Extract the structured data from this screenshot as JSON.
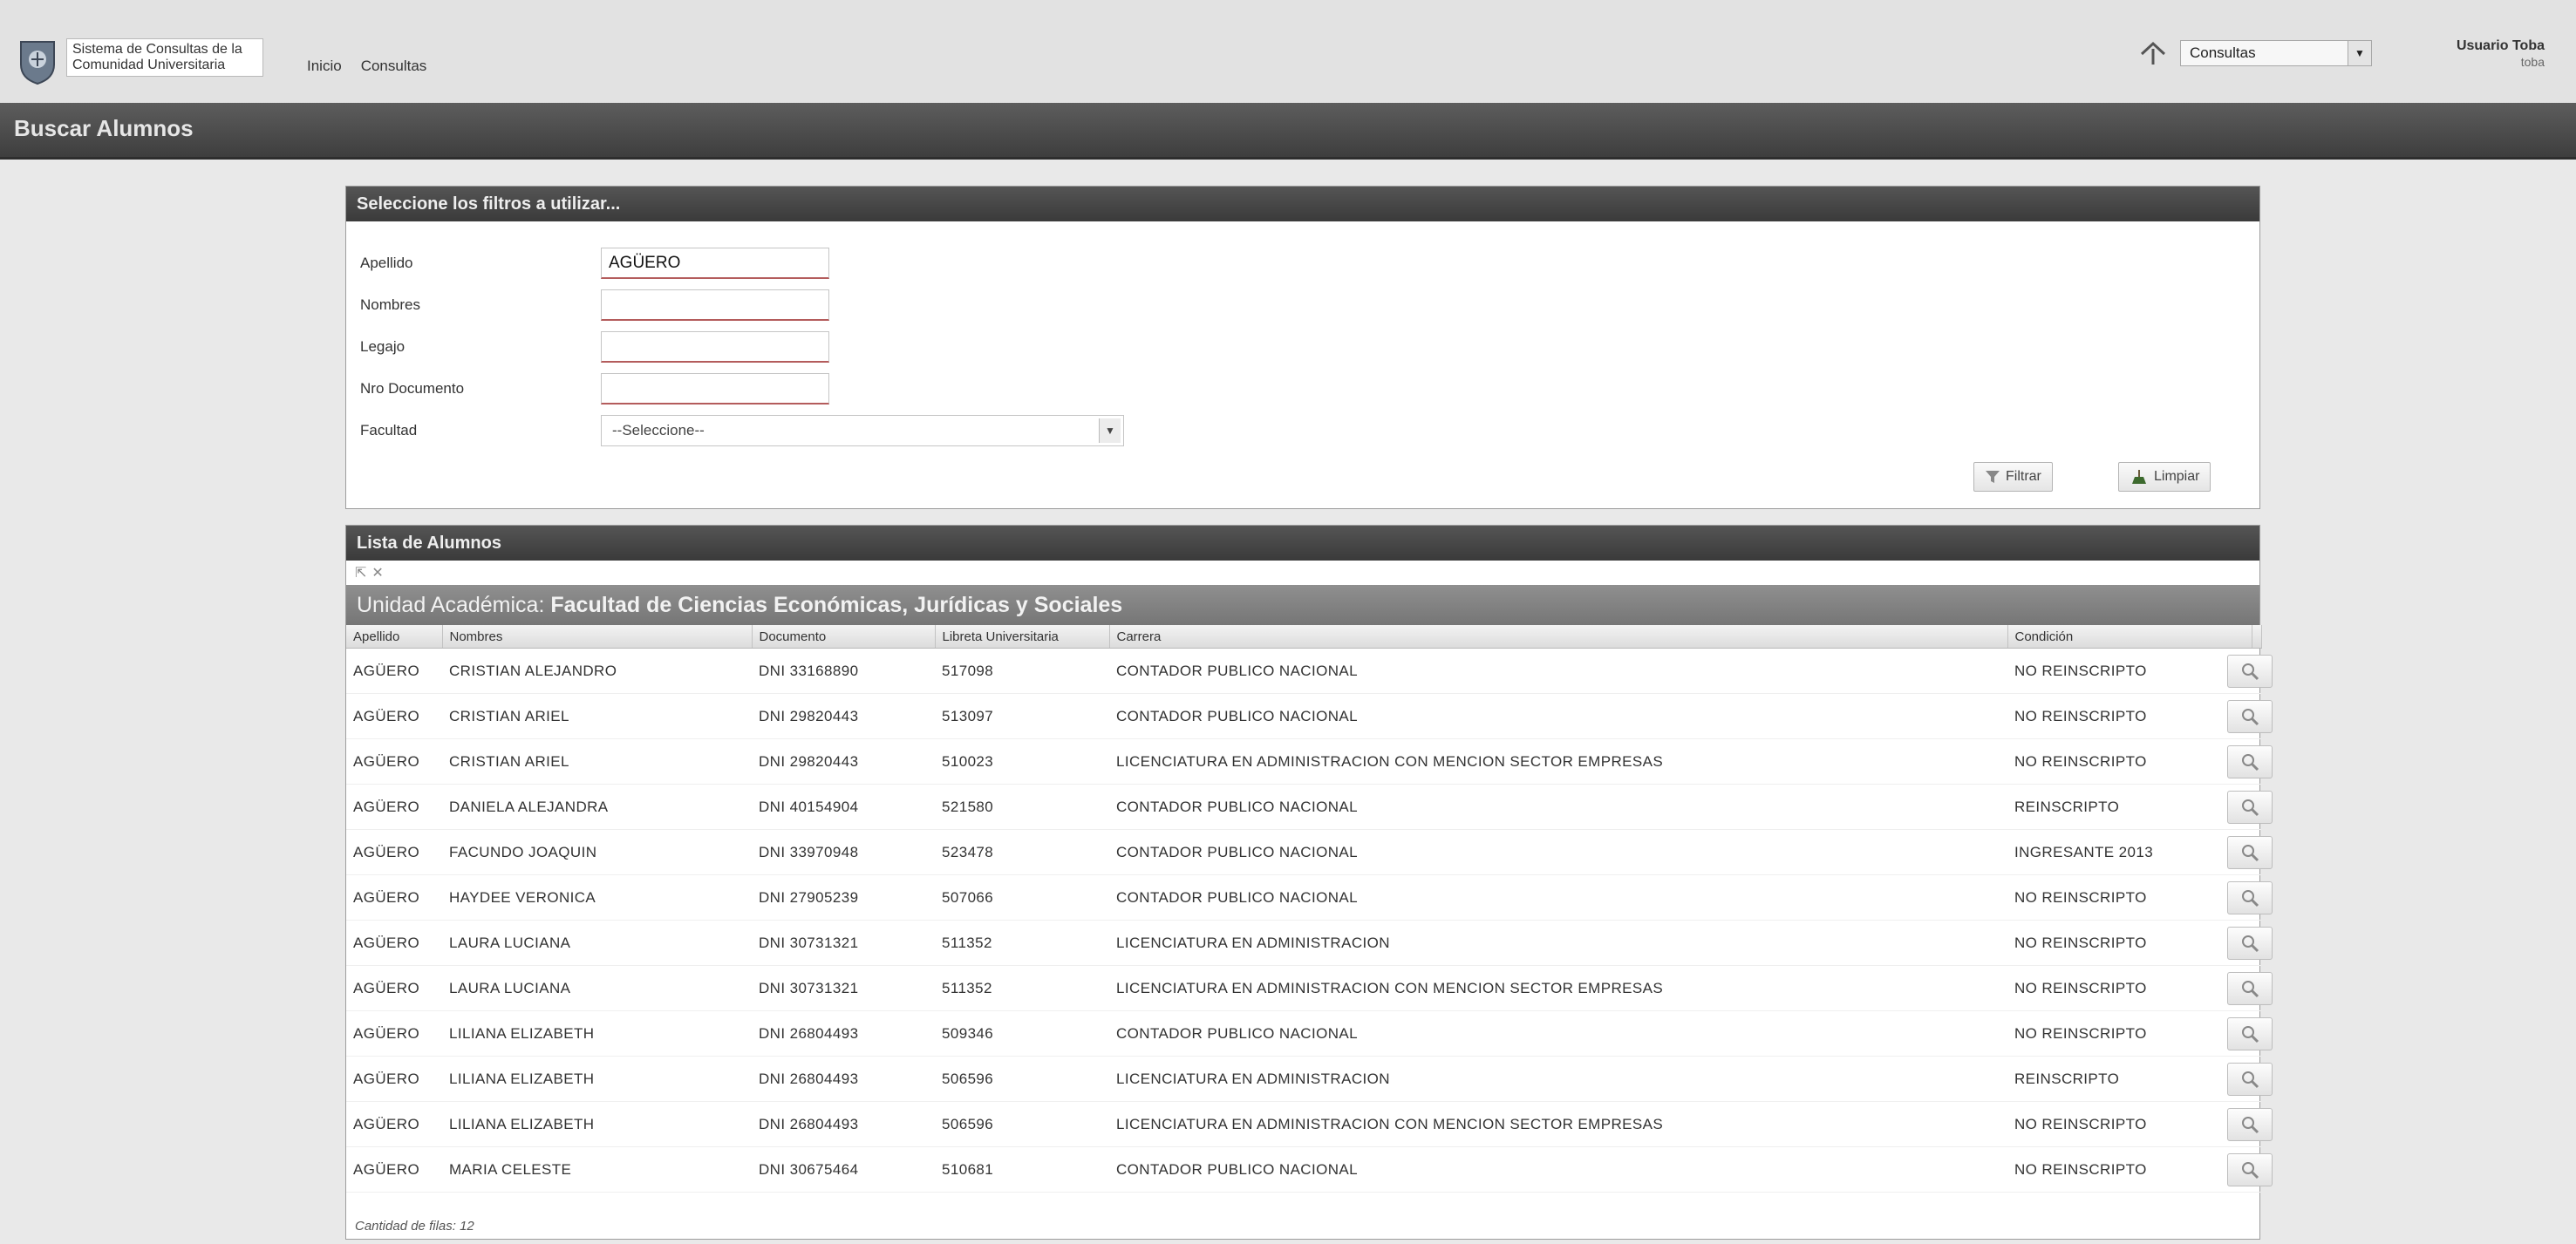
{
  "header": {
    "app_title": "Sistema de Consultas de la Comunidad Universitaria",
    "nav": [
      "Inicio",
      "Consultas"
    ],
    "context_select": "Consultas",
    "user_name": "Usuario Toba",
    "user_sub": "toba"
  },
  "page": {
    "title": "Buscar Alumnos"
  },
  "filters": {
    "title": "Seleccione los filtros a utilizar...",
    "apellido_label": "Apellido",
    "apellido_value": "AGÜERO",
    "nombres_label": "Nombres",
    "nombres_value": "",
    "legajo_label": "Legajo",
    "legajo_value": "",
    "documento_label": "Nro Documento",
    "documento_value": "",
    "facultad_label": "Facultad",
    "facultad_value": "--Seleccione--",
    "filter_button": "Filtrar",
    "clear_button": "Limpiar"
  },
  "list": {
    "title": "Lista de Alumnos",
    "group_prefix": "Unidad Académica:",
    "group_value": "Facultad de Ciencias Económicas, Jurídicas y Sociales",
    "columns": [
      "Apellido",
      "Nombres",
      "Documento",
      "Libreta Universitaria",
      "Carrera",
      "Condición",
      ""
    ],
    "rows": [
      [
        "AGÜERO",
        "CRISTIAN ALEJANDRO",
        "DNI 33168890",
        "517098",
        "CONTADOR PUBLICO NACIONAL",
        "NO REINSCRIPTO"
      ],
      [
        "AGÜERO",
        "CRISTIAN ARIEL",
        "DNI 29820443",
        "513097",
        "CONTADOR PUBLICO NACIONAL",
        "NO REINSCRIPTO"
      ],
      [
        "AGÜERO",
        "CRISTIAN ARIEL",
        "DNI 29820443",
        "510023",
        "LICENCIATURA EN ADMINISTRACION CON MENCION SECTOR EMPRESAS",
        "NO REINSCRIPTO"
      ],
      [
        "AGÜERO",
        "DANIELA ALEJANDRA",
        "DNI 40154904",
        "521580",
        "CONTADOR PUBLICO NACIONAL",
        "REINSCRIPTO"
      ],
      [
        "AGÜERO",
        "FACUNDO JOAQUIN",
        "DNI 33970948",
        "523478",
        "CONTADOR PUBLICO NACIONAL",
        "INGRESANTE 2013"
      ],
      [
        "AGÜERO",
        "HAYDEE VERONICA",
        "DNI 27905239",
        "507066",
        "CONTADOR PUBLICO NACIONAL",
        "NO REINSCRIPTO"
      ],
      [
        "AGÜERO",
        "LAURA LUCIANA",
        "DNI 30731321",
        "511352",
        "LICENCIATURA EN ADMINISTRACION",
        "NO REINSCRIPTO"
      ],
      [
        "AGÜERO",
        "LAURA LUCIANA",
        "DNI 30731321",
        "511352",
        "LICENCIATURA EN ADMINISTRACION CON MENCION SECTOR EMPRESAS",
        "NO REINSCRIPTO"
      ],
      [
        "AGÜERO",
        "LILIANA ELIZABETH",
        "DNI 26804493",
        "509346",
        "CONTADOR PUBLICO NACIONAL",
        "NO REINSCRIPTO"
      ],
      [
        "AGÜERO",
        "LILIANA ELIZABETH",
        "DNI 26804493",
        "506596",
        "LICENCIATURA EN ADMINISTRACION",
        "REINSCRIPTO"
      ],
      [
        "AGÜERO",
        "LILIANA ELIZABETH",
        "DNI 26804493",
        "506596",
        "LICENCIATURA EN ADMINISTRACION CON MENCION SECTOR EMPRESAS",
        "NO REINSCRIPTO"
      ],
      [
        "AGÜERO",
        "MARIA CELESTE",
        "DNI 30675464",
        "510681",
        "CONTADOR PUBLICO NACIONAL",
        "NO REINSCRIPTO"
      ]
    ],
    "footer": "Cantidad de filas: 12"
  }
}
